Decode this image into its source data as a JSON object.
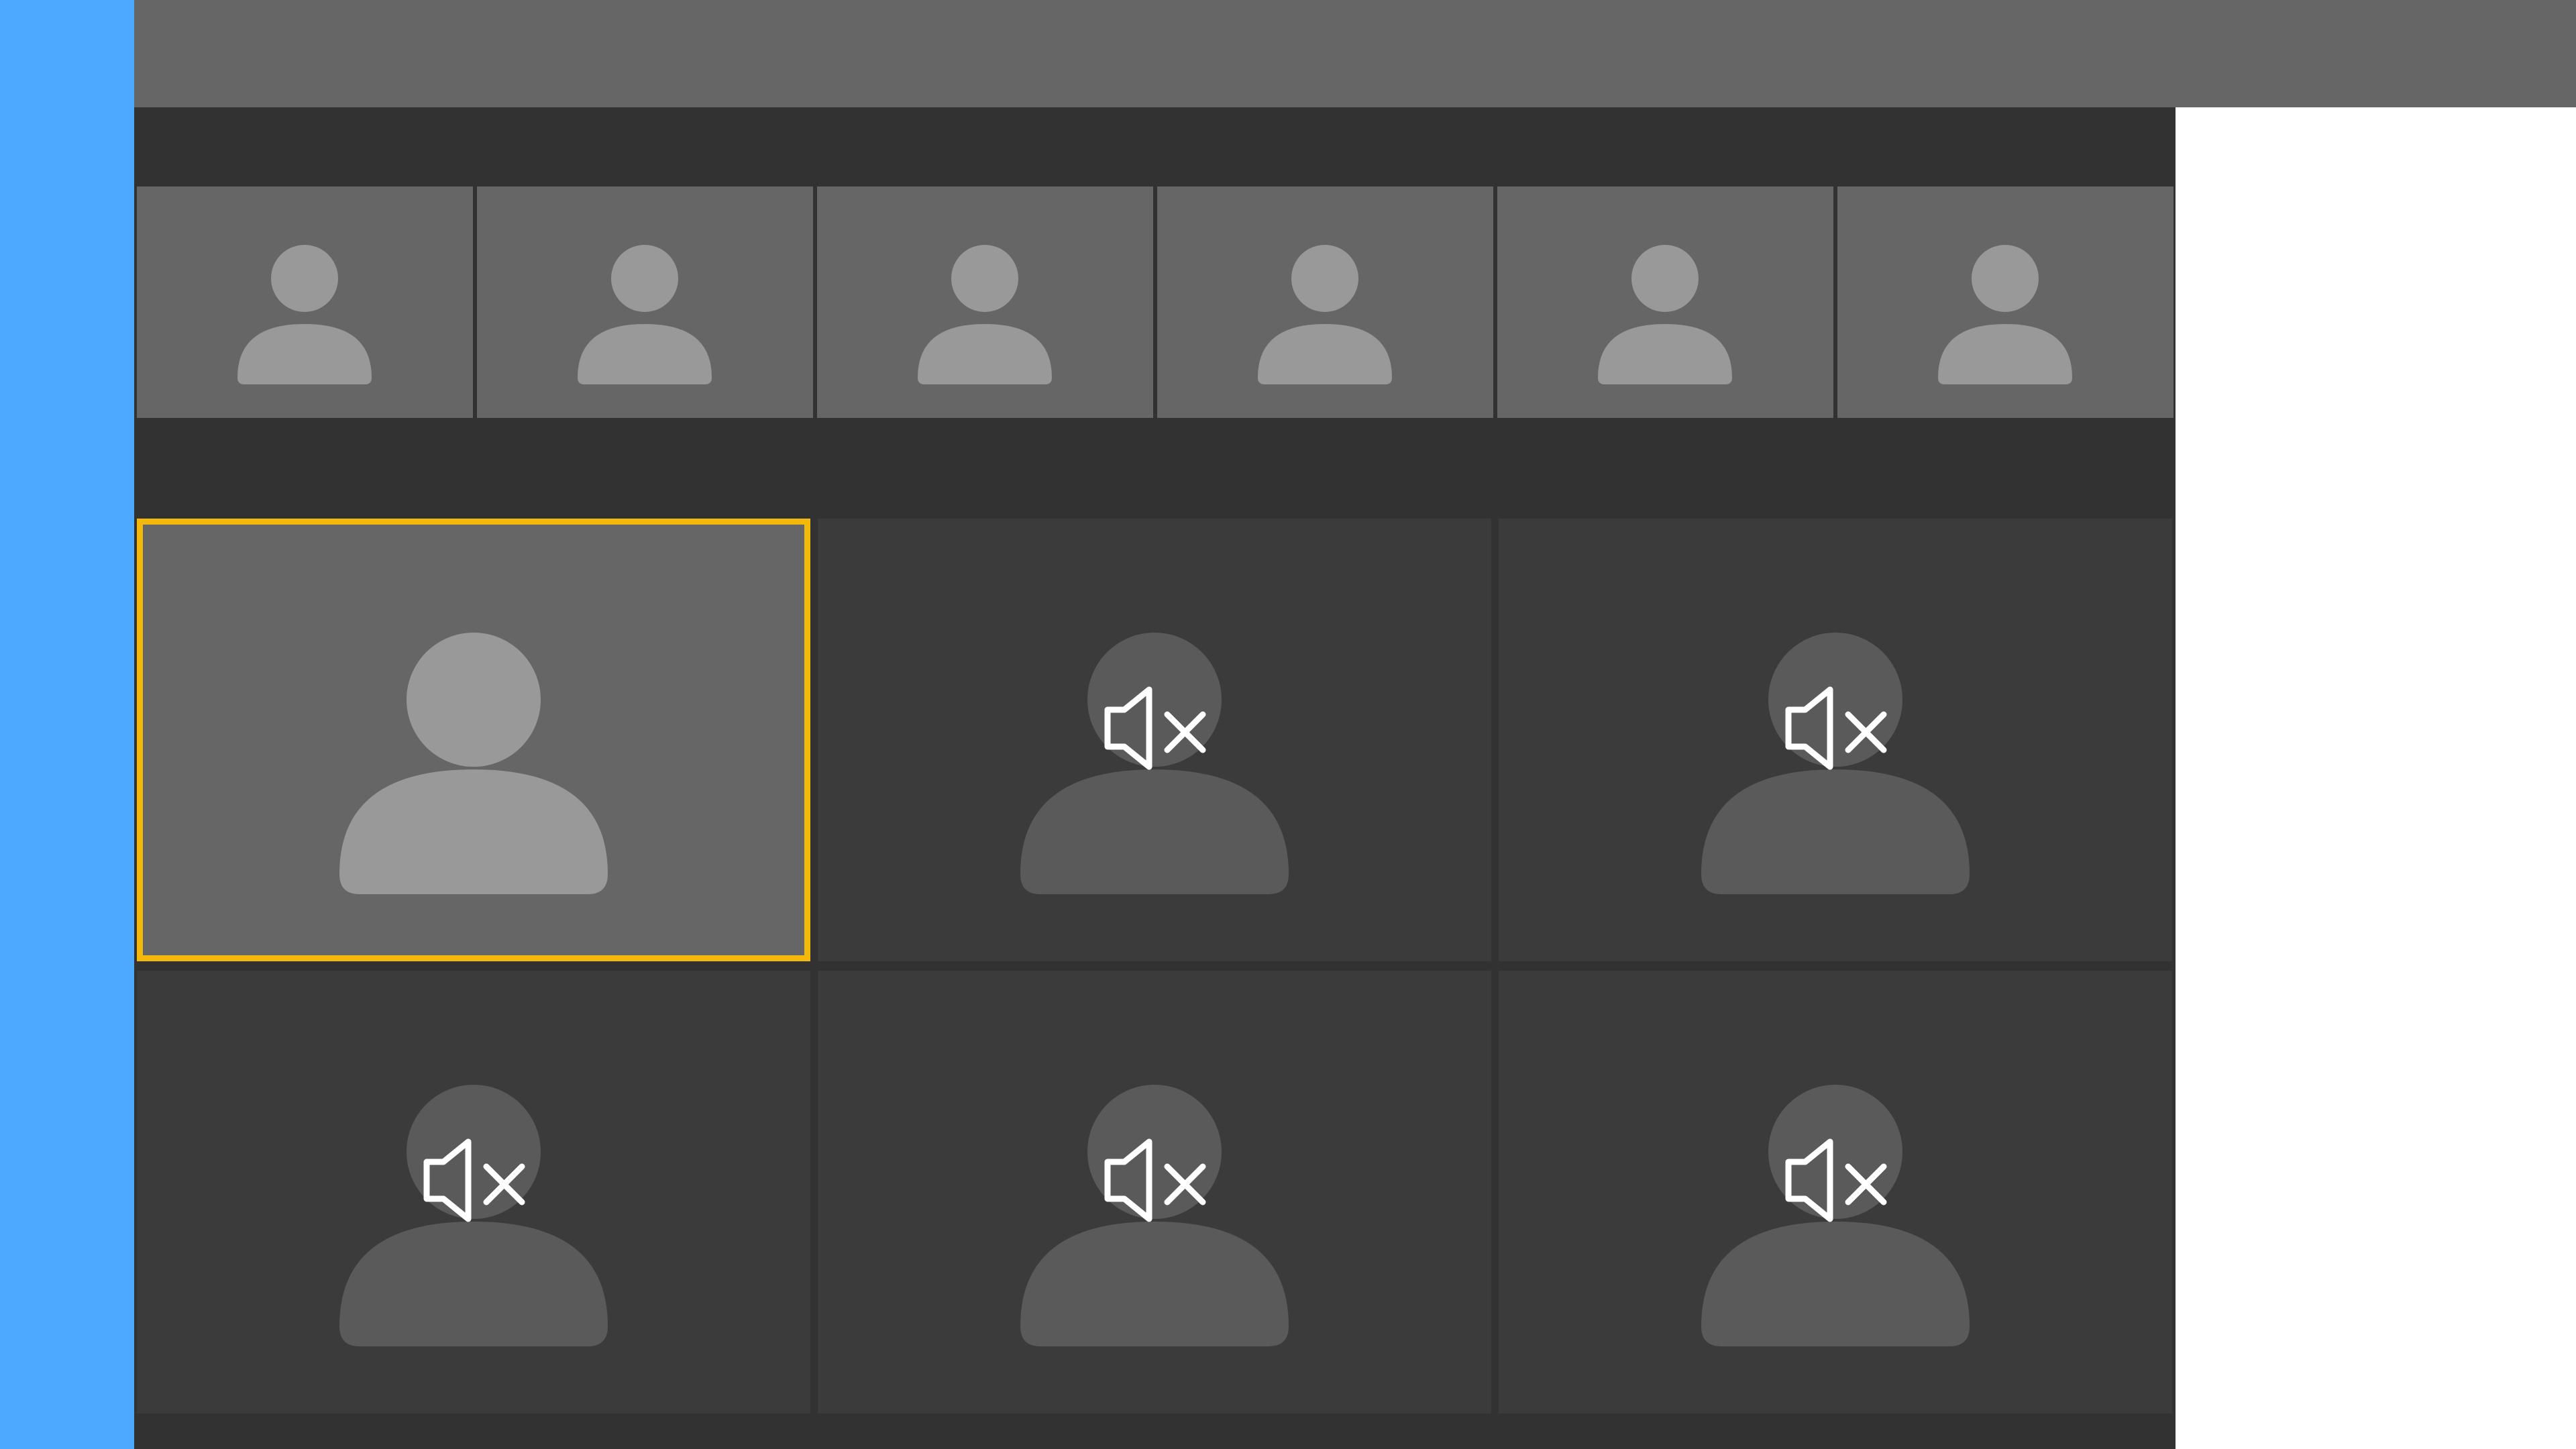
{
  "colors": {
    "sidebar": "#4da9ff",
    "topbar": "#666666",
    "stage_background": "#323232",
    "tile_background": "#3b3b3b",
    "active_tile_background": "#666666",
    "active_speaker_border": "#f2b80c",
    "avatar_light": "#999999",
    "avatar_dark": "#5a5a5a",
    "muted_icon": "#ffffff"
  },
  "filmstrip": {
    "thumbnails": [
      {
        "icon": "person-avatar-icon"
      },
      {
        "icon": "person-avatar-icon"
      },
      {
        "icon": "person-avatar-icon"
      },
      {
        "icon": "person-avatar-icon"
      },
      {
        "icon": "person-avatar-icon"
      },
      {
        "icon": "person-avatar-icon"
      }
    ]
  },
  "grid": {
    "tiles": [
      {
        "icon": "person-avatar-icon",
        "active_speaker": true,
        "muted": false
      },
      {
        "icon": "person-avatar-icon",
        "active_speaker": false,
        "muted": true,
        "status_icon": "speaker-muted-icon"
      },
      {
        "icon": "person-avatar-icon",
        "active_speaker": false,
        "muted": true,
        "status_icon": "speaker-muted-icon"
      },
      {
        "icon": "person-avatar-icon",
        "active_speaker": false,
        "muted": true,
        "status_icon": "speaker-muted-icon"
      },
      {
        "icon": "person-avatar-icon",
        "active_speaker": false,
        "muted": true,
        "status_icon": "speaker-muted-icon"
      },
      {
        "icon": "person-avatar-icon",
        "active_speaker": false,
        "muted": true,
        "status_icon": "speaker-muted-icon"
      }
    ]
  }
}
